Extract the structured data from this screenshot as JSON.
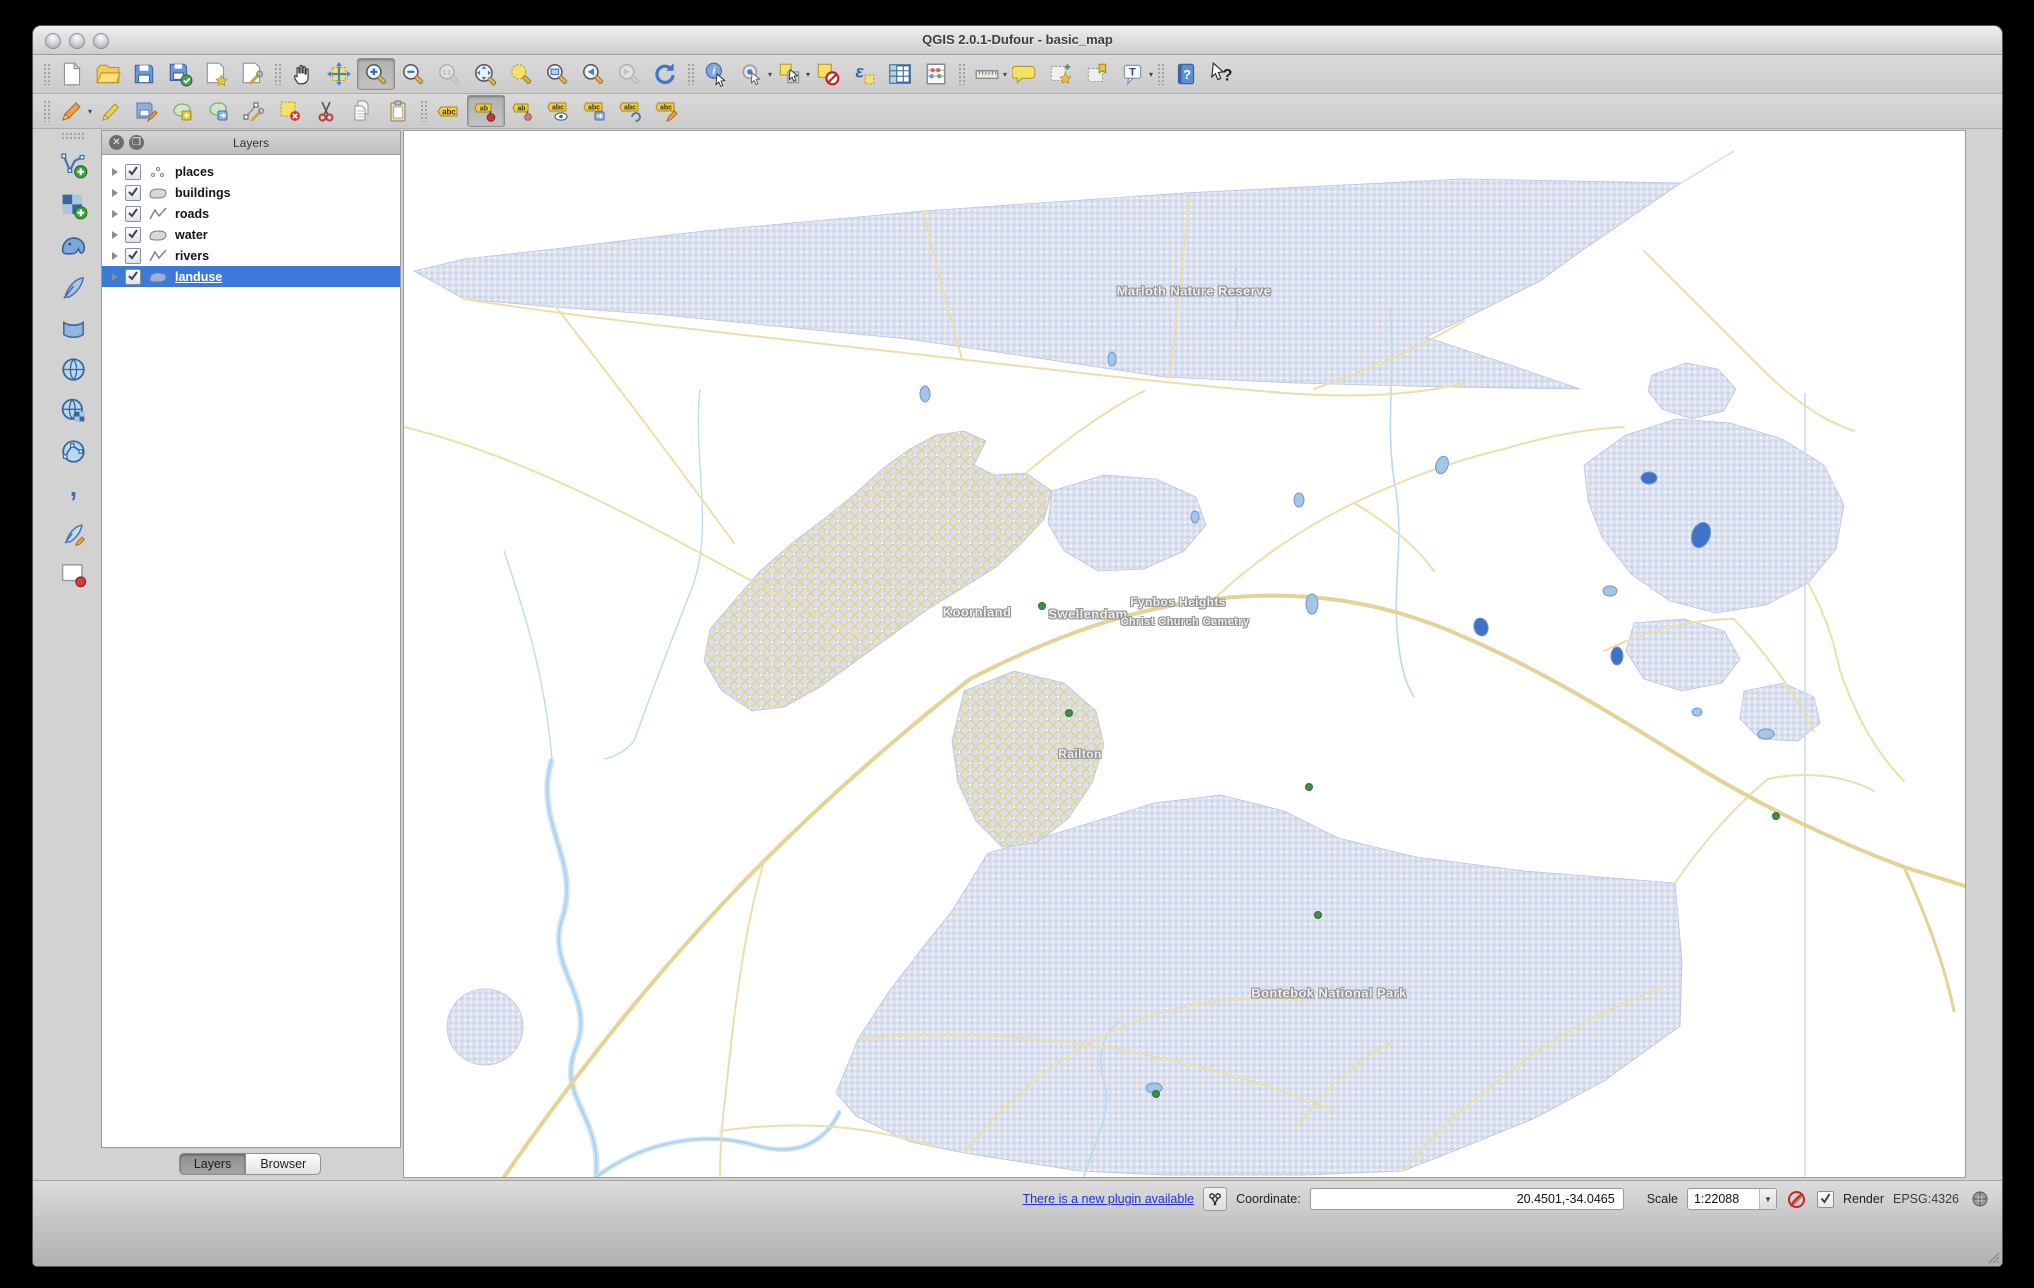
{
  "window": {
    "title": "QGIS 2.0.1-Dufour - basic_map"
  },
  "toolbar_main": {
    "tools": [
      "new-project",
      "open-project",
      "save-project",
      "save-project-as",
      "new-print-composer",
      "composer-manager",
      "pan-map",
      "pan-to-selection",
      "zoom-in",
      "zoom-out",
      "zoom-native",
      "zoom-full",
      "zoom-to-selection",
      "zoom-to-layer",
      "zoom-last",
      "zoom-next",
      "refresh-map",
      "identify-features",
      "run-feature-action",
      "select-features",
      "deselect-features",
      "select-by-expression",
      "open-attribute-table",
      "field-calculator",
      "measure-line",
      "map-tips",
      "new-bookmark",
      "show-bookmarks",
      "text-annotation",
      "help-contents",
      "whats-this"
    ],
    "active_tool": "zoom-in"
  },
  "toolbar_digitizing": {
    "tools": [
      "current-edits",
      "toggle-editing",
      "save-layer-edits",
      "add-feature",
      "move-feature",
      "node-tool",
      "delete-selected",
      "cut-features",
      "copy-features",
      "paste-features",
      "layer-labeling-options",
      "pin-unpin-labels",
      "highlight-pinned-labels",
      "show-hide-labels",
      "move-label",
      "rotate-label",
      "change-label"
    ],
    "active_tool": "pin-unpin-labels"
  },
  "toolbar_manage_layers": {
    "tools": [
      "add-vector-layer",
      "add-raster-layer",
      "add-postgis-layer",
      "add-spatialite-layer",
      "add-mssql-layer",
      "add-wms-layer",
      "add-wcs-layer",
      "add-wfs-layer",
      "add-delimited-text-layer",
      "new-shapefile-layer",
      "remove-layer"
    ]
  },
  "layers_panel": {
    "title": "Layers",
    "layers": [
      {
        "name": "places",
        "geometry": "point",
        "checked": true,
        "selected": false
      },
      {
        "name": "buildings",
        "geometry": "polygon",
        "checked": true,
        "selected": false
      },
      {
        "name": "roads",
        "geometry": "line",
        "checked": true,
        "selected": false
      },
      {
        "name": "water",
        "geometry": "polygon",
        "checked": true,
        "selected": false
      },
      {
        "name": "rivers",
        "geometry": "line",
        "checked": true,
        "selected": false
      },
      {
        "name": "landuse",
        "geometry": "polygon",
        "checked": true,
        "selected": true
      }
    ],
    "tabs": [
      {
        "label": "Layers",
        "active": true
      },
      {
        "label": "Browser",
        "active": false
      }
    ]
  },
  "map": {
    "labels": [
      {
        "text": "Marloth Nature Reserve"
      },
      {
        "text": "Koornland"
      },
      {
        "text": "Swellendam"
      },
      {
        "text": "Fynbos Heights"
      },
      {
        "text": "Christ Church Cemetry"
      },
      {
        "text": "Railton"
      },
      {
        "text": "Bontebok National Park"
      }
    ],
    "colors": {
      "landuse": "#dce1f0",
      "roads": "#e7d9a2",
      "rivers": "#b7d9f1",
      "water": "#a3c6e8",
      "places": "#3f8f43"
    }
  },
  "status_bar": {
    "plugin_link": "There is a new plugin available",
    "coordinate_label": "Coordinate:",
    "coordinate_value": "20.4501,-34.0465",
    "scale_label": "Scale",
    "scale_value": "1:22088",
    "render_label": "Render",
    "render_checked": true,
    "crs_label": "EPSG:4326"
  },
  "colors": {
    "selection_blue": "#3c79d8",
    "link_blue": "#2330dd"
  }
}
